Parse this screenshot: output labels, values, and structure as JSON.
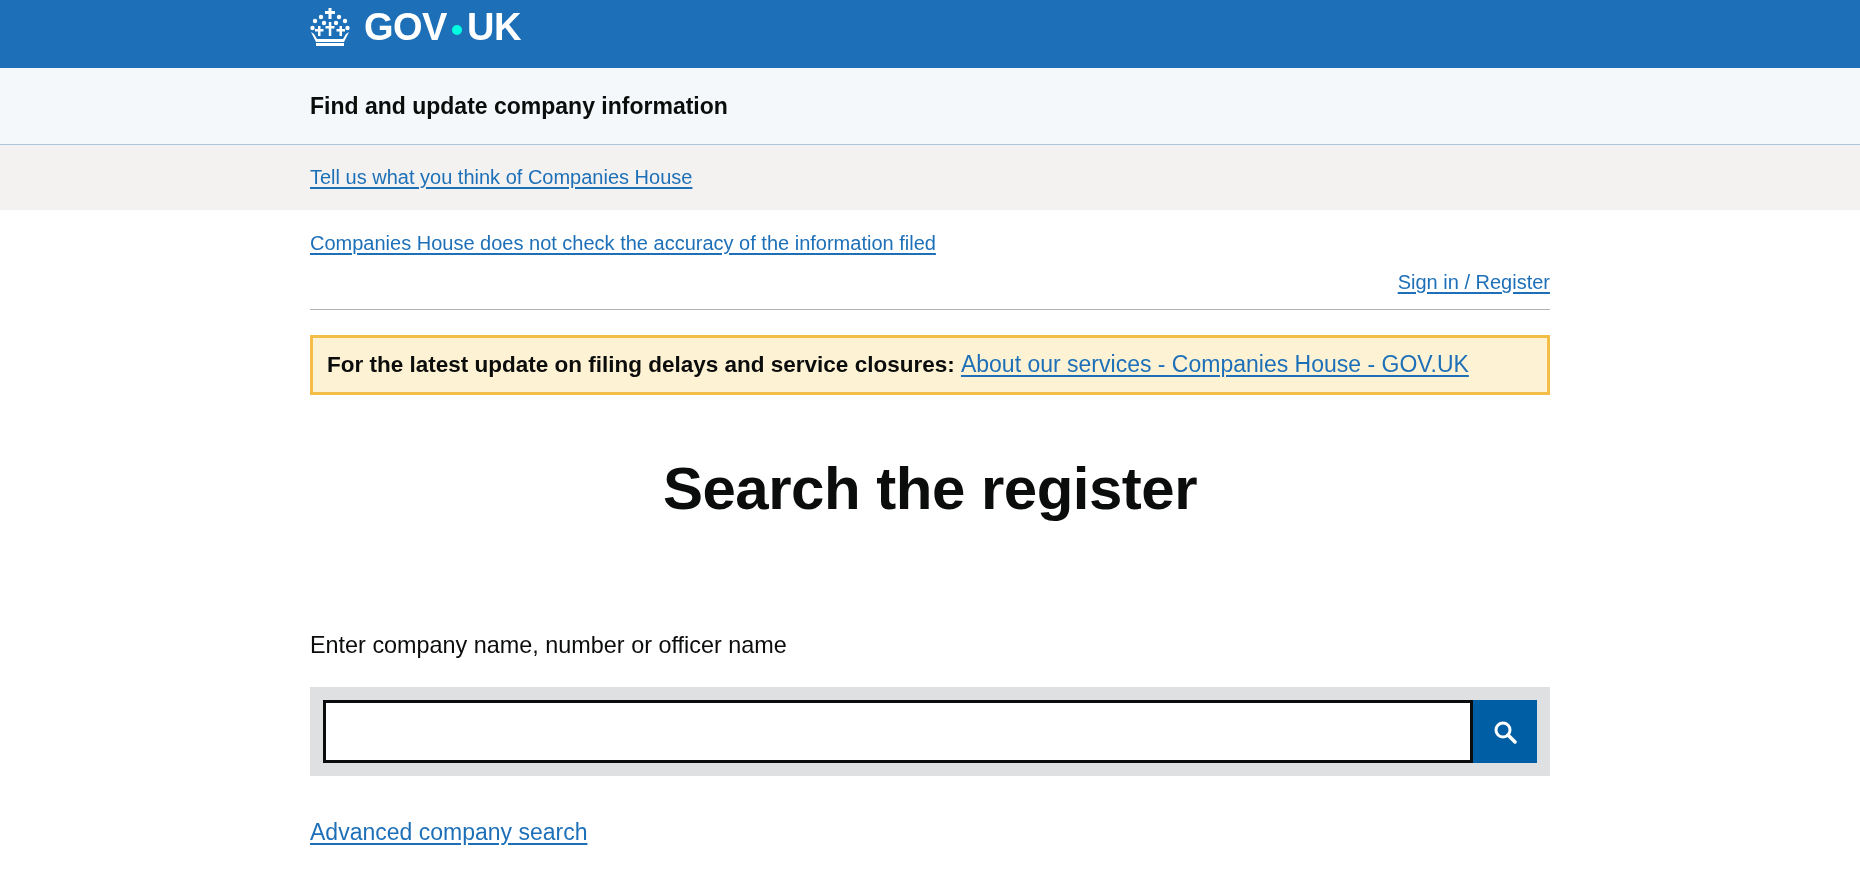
{
  "header": {
    "logo_words": [
      "GOV",
      "UK"
    ]
  },
  "service_bar": {
    "title": "Find and update company information"
  },
  "feedback_bar": {
    "link": "Tell us what you think of Companies House"
  },
  "accuracy_link": "Companies House does not check the accuracy of the information filed",
  "account_link": "Sign in / Register",
  "notice": {
    "text": "For the latest update on filing delays and service closures:",
    "link": "About our services - Companies House - GOV.UK"
  },
  "heading": "Search the register",
  "search": {
    "label": "Enter company name, number or officer name"
  },
  "advanced_link": "Advanced company search"
}
